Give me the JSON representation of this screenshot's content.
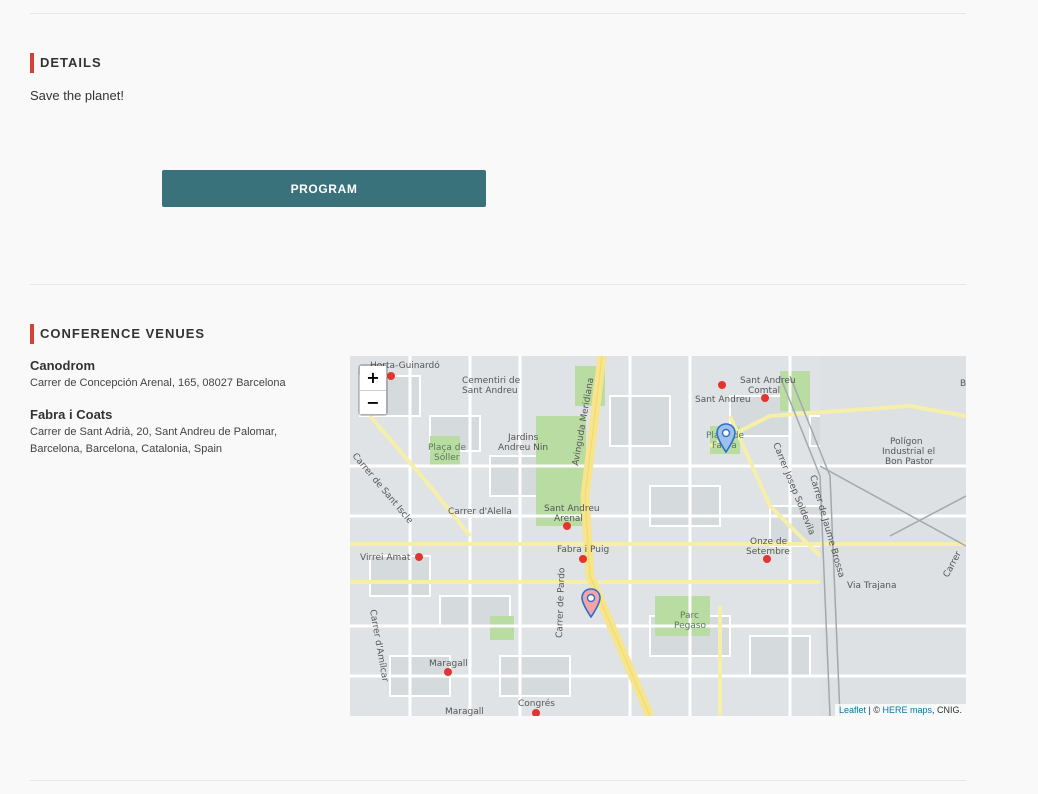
{
  "details": {
    "title": "DETAILS",
    "text": "Save the planet!",
    "program_label": "PROGRAM"
  },
  "venues": {
    "title": "CONFERENCE VENUES",
    "items": [
      {
        "name": "Canodrom",
        "address": "Carrer de Concepción Arenal, 165, 08027 Barcelona"
      },
      {
        "name": "Fabra i Coats",
        "address": "Carrer de Sant Adrià, 20, Sant Andreu de Palomar, Barcelona, Barcelona, Catalonia, Spain"
      }
    ]
  },
  "map": {
    "zoom_in": "+",
    "zoom_out": "−",
    "attribution": {
      "leaflet": "Leaflet",
      "separator": " | © ",
      "here": "HERE maps",
      "rest": ", CNIG."
    },
    "labels": {
      "horta": "Horta-Guinardó",
      "cementiri": "Cementiri de",
      "cementiri2": "Sant Andreu",
      "jardins": "Jardins",
      "jardins2": "Andreu Nin",
      "placa_soller": "Plaça de",
      "placa_soller2": "Sóller",
      "avinguda": "Avinguda Meridiana",
      "sant_andreu_comtal": "Sant Andreu",
      "sant_andreu_comtal2": "Comtal",
      "sant_andreu": "Sant Andreu",
      "placa_fabra": "Plaça de",
      "placa_fabra2": "Fabra",
      "poligon": "Polígon",
      "poligon2": "Industrial el",
      "poligon3": "Bon Pastor",
      "josep_soldevila": "Carrer Josep Soldevila",
      "jaume_brossa": "Carrer de Jaume Brossa",
      "sant_iscle": "Carrer de Sant Iscle",
      "carrer_alella": "Carrer d'Alella",
      "sant_andreu_arenal": "Sant Andreu",
      "sant_andreu_arenal2": "Arenal",
      "fabra_puig": "Fabra i Puig",
      "onze": "Onze de",
      "onze2": "Setembre",
      "virrei_amat": "Virrei Amat",
      "via_trajana": "Via Trajana",
      "carrer_pardo": "Carrer de Pardo",
      "parc_pegaso": "Parc",
      "parc_pegaso2": "Pegaso",
      "carrer_amilcar": "Carrer d'Amílcar",
      "maragall": "Maragall",
      "maragall2": "Maragall",
      "congres": "Congrés",
      "carrer_right": "Carrer",
      "b": "B"
    },
    "colors": {
      "land": "#dfe3e6",
      "road": "#ffffff",
      "main_road": "#f5efaa",
      "meridiana": "#f6e58d",
      "park": "#b9dca3",
      "building": "#d3d8dc",
      "marker_blue": "#2a6fc9",
      "marker_pink": "#f4a3a8"
    }
  }
}
